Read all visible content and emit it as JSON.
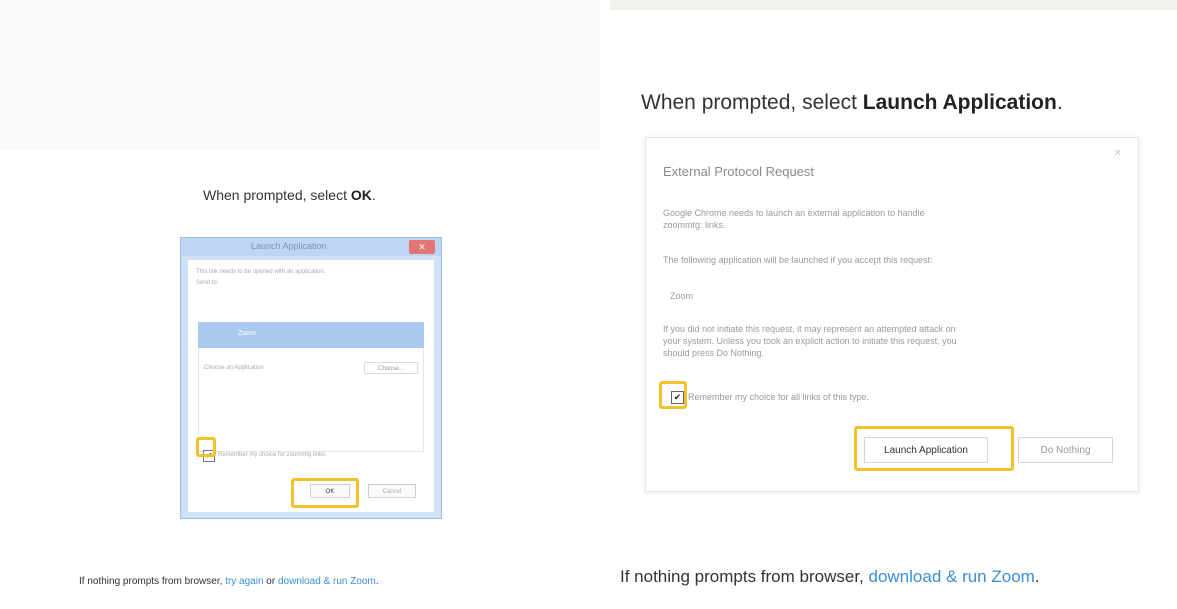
{
  "left": {
    "instruction_prefix": "When prompted, select ",
    "instruction_bold": "OK",
    "instruction_suffix": ".",
    "dialog": {
      "title": "Launch Application",
      "close_glyph": "✕",
      "description": "This link needs to be opened with an application.",
      "send_to": "Send to:",
      "app_name": "Zoom",
      "choose_label": "Choose an Application",
      "choose_button": "Choose...",
      "remember_label": "Remember my choice for zoommtg links.",
      "ok_button": "OK",
      "cancel_button": "Cancel"
    },
    "footer_prefix": "If nothing prompts from browser, ",
    "try_again_link": "try again",
    "footer_or": " or ",
    "download_link": "download & run Zoom",
    "footer_end": "."
  },
  "right": {
    "instruction_prefix": "When prompted, select ",
    "instruction_bold": "Launch Application",
    "instruction_suffix": ".",
    "dialog": {
      "title": "External Protocol Request",
      "close_glyph": "✕",
      "line1": "Google Chrome needs to launch an external application to handle",
      "line2": "zoommtg: links.",
      "line3": "The following application will be launched if you accept this request:",
      "app_name": "Zoom",
      "warn1": "If you did not initiate this request, it may represent an attempted attack on",
      "warn2": "your system. Unless you took an explicit action to initiate this request, you",
      "warn3": "should press Do Nothing.",
      "remember_label": "Remember my choice for all links of this type.",
      "launch_button": "Launch Application",
      "nothing_button": "Do Nothing"
    },
    "footer_prefix": "If nothing prompts from browser, ",
    "download_link": "download & run Zoom",
    "footer_end": "."
  },
  "colors": {
    "highlight": "#f2c12e",
    "link": "#3b8fd6",
    "win_accent": "#a9c9ef"
  },
  "icons": {
    "checkbox_checked": "✔"
  }
}
